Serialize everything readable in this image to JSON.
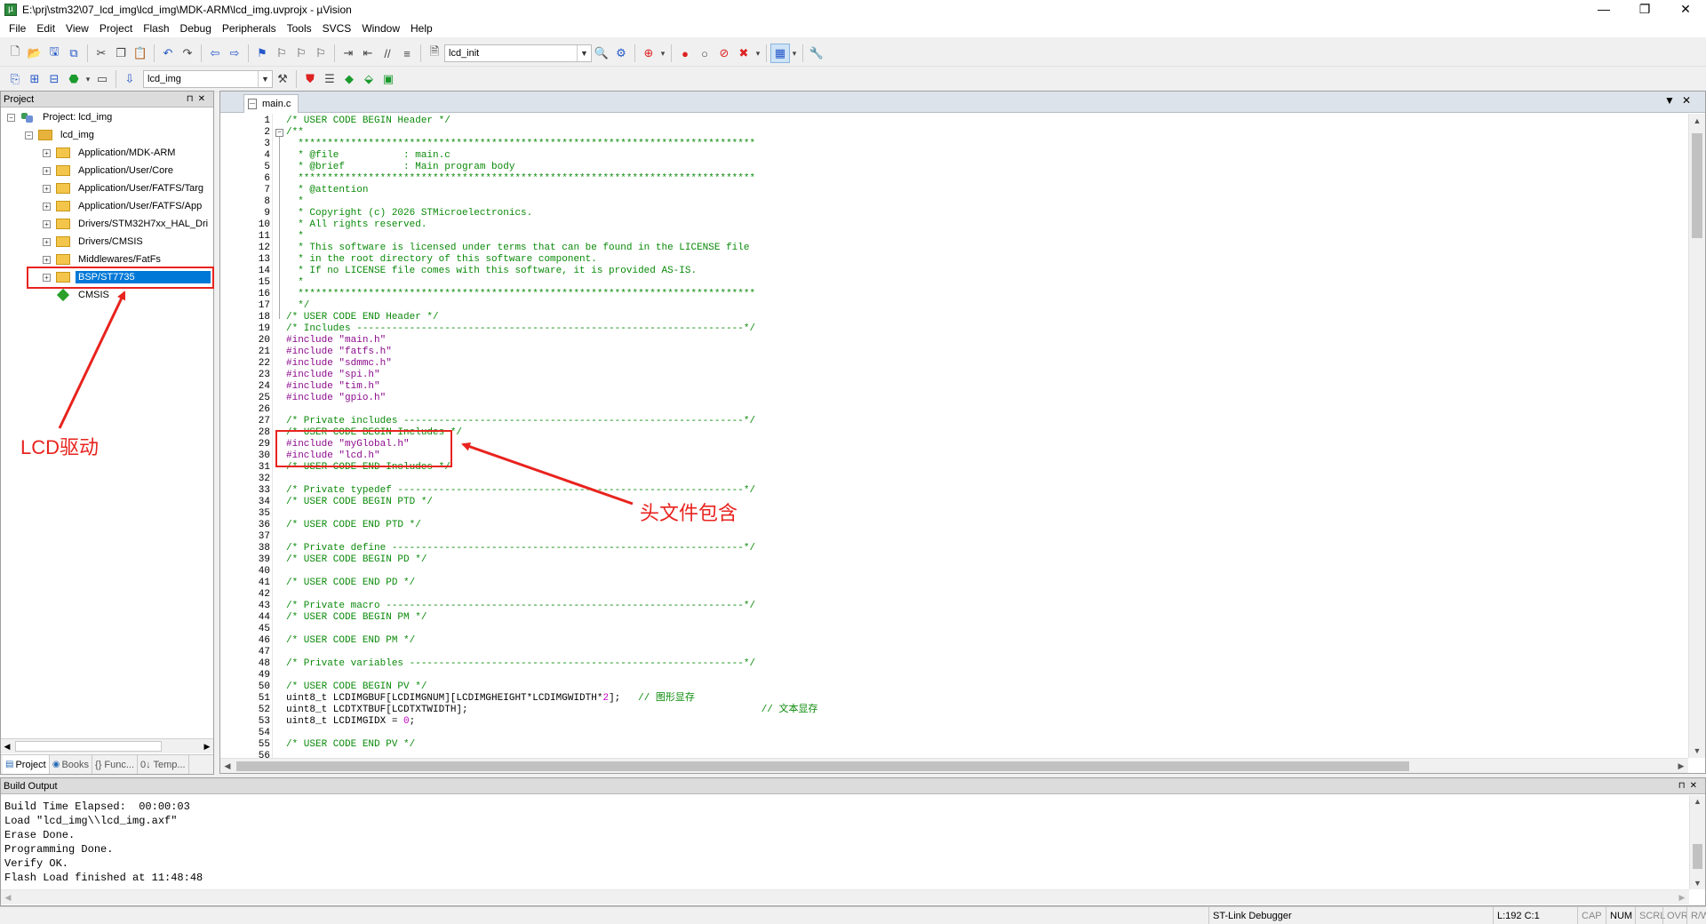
{
  "window": {
    "title": "E:\\prj\\stm32\\07_lcd_img\\lcd_img\\MDK-ARM\\lcd_img.uvprojx - µVision",
    "controls": [
      "—",
      "❐",
      "✕"
    ]
  },
  "menu": [
    "File",
    "Edit",
    "View",
    "Project",
    "Flash",
    "Debug",
    "Peripherals",
    "Tools",
    "SVCS",
    "Window",
    "Help"
  ],
  "toolbar": {
    "find_combo": "lcd_init",
    "target_combo": "lcd_img"
  },
  "project_panel": {
    "title": "Project",
    "root": "Project: lcd_img",
    "target": "lcd_img",
    "groups": [
      "Application/MDK-ARM",
      "Application/User/Core",
      "Application/User/FATFS/Targ",
      "Application/User/FATFS/App",
      "Drivers/STM32H7xx_HAL_Dri",
      "Drivers/CMSIS",
      "Middlewares/FatFs",
      "BSP/ST7735"
    ],
    "cmsis": "CMSIS",
    "selected": "BSP/ST7735",
    "tabs": [
      "Project",
      "Books",
      "{} Func...",
      "0↓ Temp..."
    ]
  },
  "editor": {
    "tab": "main.c",
    "lines": [
      "/* USER CODE BEGIN Header */",
      "/**",
      "  ******************************************************************************",
      "  * @file           : main.c",
      "  * @brief          : Main program body",
      "  ******************************************************************************",
      "  * @attention",
      "  *",
      "  * Copyright (c) 2026 STMicroelectronics.",
      "  * All rights reserved.",
      "  *",
      "  * This software is licensed under terms that can be found in the LICENSE file",
      "  * in the root directory of this software component.",
      "  * If no LICENSE file comes with this software, it is provided AS-IS.",
      "  *",
      "  ******************************************************************************",
      "  */",
      "/* USER CODE END Header */",
      "/* Includes ------------------------------------------------------------------*/",
      "#include \"main.h\"",
      "#include \"fatfs.h\"",
      "#include \"sdmmc.h\"",
      "#include \"spi.h\"",
      "#include \"tim.h\"",
      "#include \"gpio.h\"",
      "",
      "/* Private includes ----------------------------------------------------------*/",
      "/* USER CODE BEGIN Includes */",
      "#include \"myGlobal.h\"",
      "#include \"lcd.h\"",
      "/* USER CODE END Includes */",
      "",
      "/* Private typedef -----------------------------------------------------------*/",
      "/* USER CODE BEGIN PTD */",
      "",
      "/* USER CODE END PTD */",
      "",
      "/* Private define ------------------------------------------------------------*/",
      "/* USER CODE BEGIN PD */",
      "",
      "/* USER CODE END PD */",
      "",
      "/* Private macro -------------------------------------------------------------*/",
      "/* USER CODE BEGIN PM */",
      "",
      "/* USER CODE END PM */",
      "",
      "/* Private variables ---------------------------------------------------------*/",
      "",
      "/* USER CODE BEGIN PV */",
      "uint8_t LCDIMGBUF[LCDIMGNUM][LCDIMGHEIGHT*LCDIMGWIDTH*2];   // 图形显存",
      "uint8_t LCDTXTBUF[LCDTXTWIDTH];                                                  // 文本显存",
      "uint8_t LCDIMGIDX = 0;",
      "",
      "/* USER CODE END PV */",
      ""
    ]
  },
  "annotations": {
    "lcd_driver": "LCD驱动",
    "header_include": "头文件包含"
  },
  "build_output": {
    "title": "Build Output",
    "lines": [
      "Build Time Elapsed:  00:00:03",
      "Load \"lcd_img\\\\lcd_img.axf\"",
      "Erase Done.",
      "Programming Done.",
      "Verify OK.",
      "Flash Load finished at 11:48:48"
    ]
  },
  "status": {
    "debugger": "ST-Link Debugger",
    "position": "L:192 C:1",
    "cap": "CAP",
    "num": "NUM",
    "scrl": "SCRL",
    "ovr": "OVR",
    "rw": "R/W"
  },
  "colors": {
    "selection": "#0078d7",
    "annotation": "#e8231e",
    "comment": "#0a8a0a",
    "preprocessor": "#8b0a8b"
  }
}
